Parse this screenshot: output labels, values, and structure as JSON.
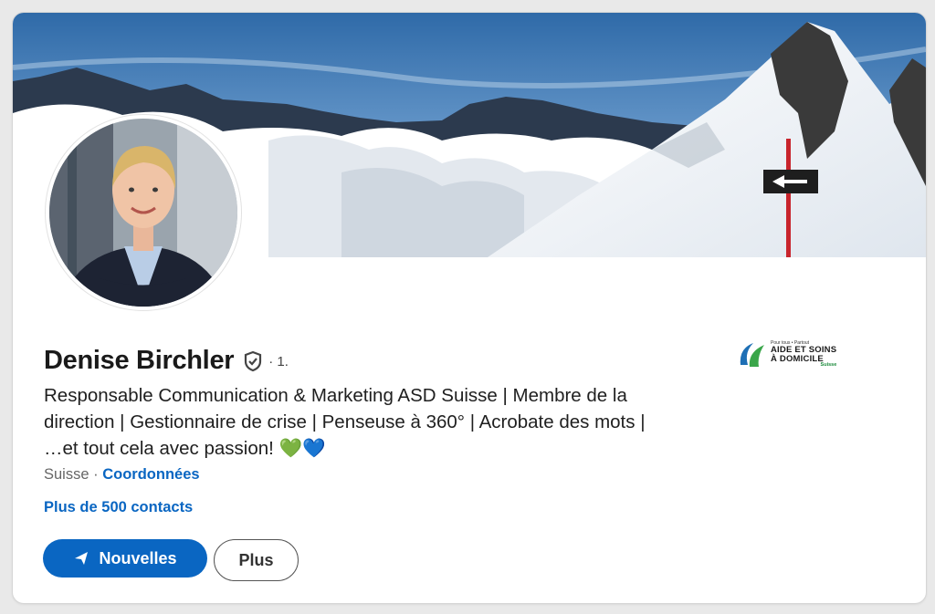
{
  "profile": {
    "name": "Denise Birchler",
    "degree": "· 1.",
    "headline": "Responsable Communication & Marketing ASD Suisse | Membre de la direction | Gestionnaire de crise | Penseuse à 360° | Acrobate des mots | …et tout cela avec passion! 💚💙",
    "location": "Suisse",
    "location_separator": "·",
    "contact_info_link": "Coordonnées",
    "connections": "Plus de 500 contacts"
  },
  "actions": {
    "primary_label": "Nouvelles",
    "secondary_label": "Plus"
  },
  "company": {
    "tagline": "Pour tous • Partout",
    "line1": "AIDE ET SOINS",
    "line2": "À DOMICILE",
    "subline": "Suisse"
  },
  "icons": {
    "verified": "shield-check-icon",
    "send": "paper-plane-icon"
  },
  "colors": {
    "accent": "#0a66c2",
    "text": "#1a1a1a",
    "muted": "#666666",
    "logo_blue": "#1e6fb5",
    "logo_green": "#3aa64a"
  }
}
